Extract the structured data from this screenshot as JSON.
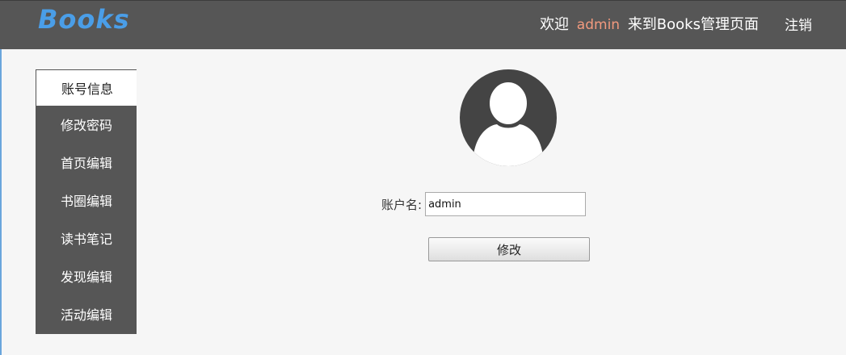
{
  "header": {
    "logo": "Books",
    "welcome_prefix": "欢迎",
    "username": "admin",
    "welcome_suffix": "来到Books管理页面",
    "logout_label": "注销"
  },
  "sidebar": {
    "items": [
      {
        "label": "账号信息",
        "active": true
      },
      {
        "label": "修改密码"
      },
      {
        "label": "首页编辑"
      },
      {
        "label": "书圈编辑"
      },
      {
        "label": "读书笔记"
      },
      {
        "label": "发现编辑"
      },
      {
        "label": "活动编辑"
      }
    ]
  },
  "main": {
    "avatar_icon": "user-avatar-icon",
    "account_label": "账户名:",
    "account_value": "admin",
    "submit_label": "修改"
  },
  "colors": {
    "header_bg": "#565656",
    "logo": "#4a9ee8",
    "username": "#f39a7e",
    "sidebar_bg": "#565656"
  }
}
